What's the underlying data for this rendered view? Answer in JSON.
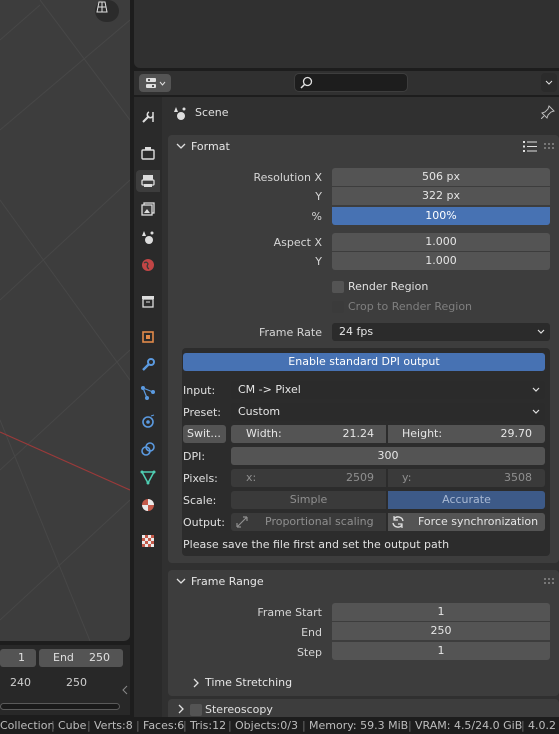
{
  "viewport": {
    "grid_icon": "grid-perspective-icon"
  },
  "timeline": {
    "current_frame": "1",
    "end_label": "End",
    "end_value": "250",
    "ruler": [
      "240",
      "250"
    ]
  },
  "properties": {
    "search_placeholder": "",
    "context_title": "Scene",
    "tabs": [
      "tool",
      "render",
      "output",
      "view-layer",
      "scene",
      "world",
      "collection",
      "object",
      "modifier",
      "particles",
      "physics",
      "constraints",
      "data",
      "material",
      "texture"
    ],
    "format": {
      "title": "Format",
      "resolution_x_label": "Resolution X",
      "resolution_x": "506 px",
      "resolution_y_label": "Y",
      "resolution_y": "322 px",
      "percent_label": "%",
      "percent": "100%",
      "percent_value": 1.0,
      "aspect_x_label": "Aspect X",
      "aspect_x": "1.000",
      "aspect_y_label": "Y",
      "aspect_y": "1.000",
      "render_region": "Render Region",
      "crop_region": "Crop to Render Region",
      "frame_rate_label": "Frame Rate",
      "frame_rate": "24 fps"
    },
    "dpi_addon": {
      "enable_button": "Enable standard DPI output",
      "input_label": "Input:",
      "input_value": "CM -> Pixel",
      "preset_label": "Preset:",
      "preset_value": "Custom",
      "switch_button": "Swit...",
      "width_label": "Width:",
      "width_value": "21.24",
      "height_label": "Height:",
      "height_value": "29.70",
      "dpi_label": "DPI:",
      "dpi_value": "300",
      "pixels_label": "Pixels:",
      "px_x_label": "x:",
      "px_x_value": "2509",
      "px_y_label": "y:",
      "px_y_value": "3508",
      "scale_label": "Scale:",
      "scale_simple": "Simple",
      "scale_accurate": "Accurate",
      "output_label": "Output:",
      "output_proportional": "Proportional scaling",
      "output_force": "Force synchronization",
      "message": "Please save the file first and set the output path"
    },
    "frame_range": {
      "title": "Frame Range",
      "start_label": "Frame Start",
      "start": "1",
      "end_label": "End",
      "end": "250",
      "step_label": "Step",
      "step": "1",
      "time_stretching": "Time Stretching"
    },
    "stereoscopy": {
      "title": "Stereoscopy"
    }
  },
  "statusbar": {
    "collection": "Collection",
    "object": "Cube",
    "verts": "Verts:8",
    "faces": "Faces:6",
    "tris": "Tris:12",
    "objects": "Objects:0/3",
    "memory": "Memory: 59.3 MiB",
    "vram": "VRAM: 4.5/24.0 GiB",
    "version": "4.0.2"
  },
  "colors": {
    "accent": "#4772b3",
    "panel": "#3d3d3d",
    "field": "#545454",
    "axis_x": "#b34545"
  }
}
